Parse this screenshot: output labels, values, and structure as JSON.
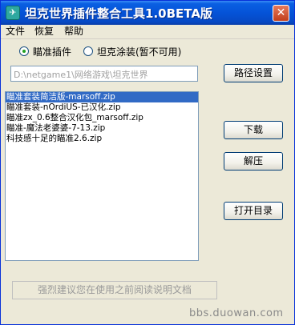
{
  "window": {
    "title": "坦克世界插件整合工具1.0BETA版",
    "icon": "app-icon",
    "close_label": "✕"
  },
  "menu": {
    "items": [
      {
        "label": "文件"
      },
      {
        "label": "恢复"
      },
      {
        "label": "帮助"
      }
    ]
  },
  "mode": {
    "options": [
      {
        "label": "瞄准插件",
        "selected": true
      },
      {
        "label": "坦克涂装(暂不可用)",
        "selected": false
      }
    ]
  },
  "path": {
    "value": "D:\\netgame1\\网络游戏\\坦克世界"
  },
  "buttons": {
    "path_settings": "路径设置",
    "download": "下载",
    "extract": "解压",
    "open_dir": "打开目录"
  },
  "files": {
    "items": [
      {
        "label": "瞄准套装简洁版-marsoff.zip",
        "selected": true
      },
      {
        "label": "瞄准套装-nOrdiUS-已汉化.zip",
        "selected": false
      },
      {
        "label": "瞄准zx_0.6整合汉化包_marsoff.zip",
        "selected": false
      },
      {
        "label": "瞄准-魔法老婆婆-7-13.zip",
        "selected": false
      },
      {
        "label": "科技感十足的瞄准2.6.zip",
        "selected": false
      }
    ]
  },
  "hint": {
    "text": "强烈建议您在使用之前阅读说明文档"
  },
  "watermark": {
    "text": "bbs.duowan.com"
  },
  "colors": {
    "titlebar": "#0553d8",
    "selection": "#316ac5",
    "window_bg": "#ece9d8"
  }
}
